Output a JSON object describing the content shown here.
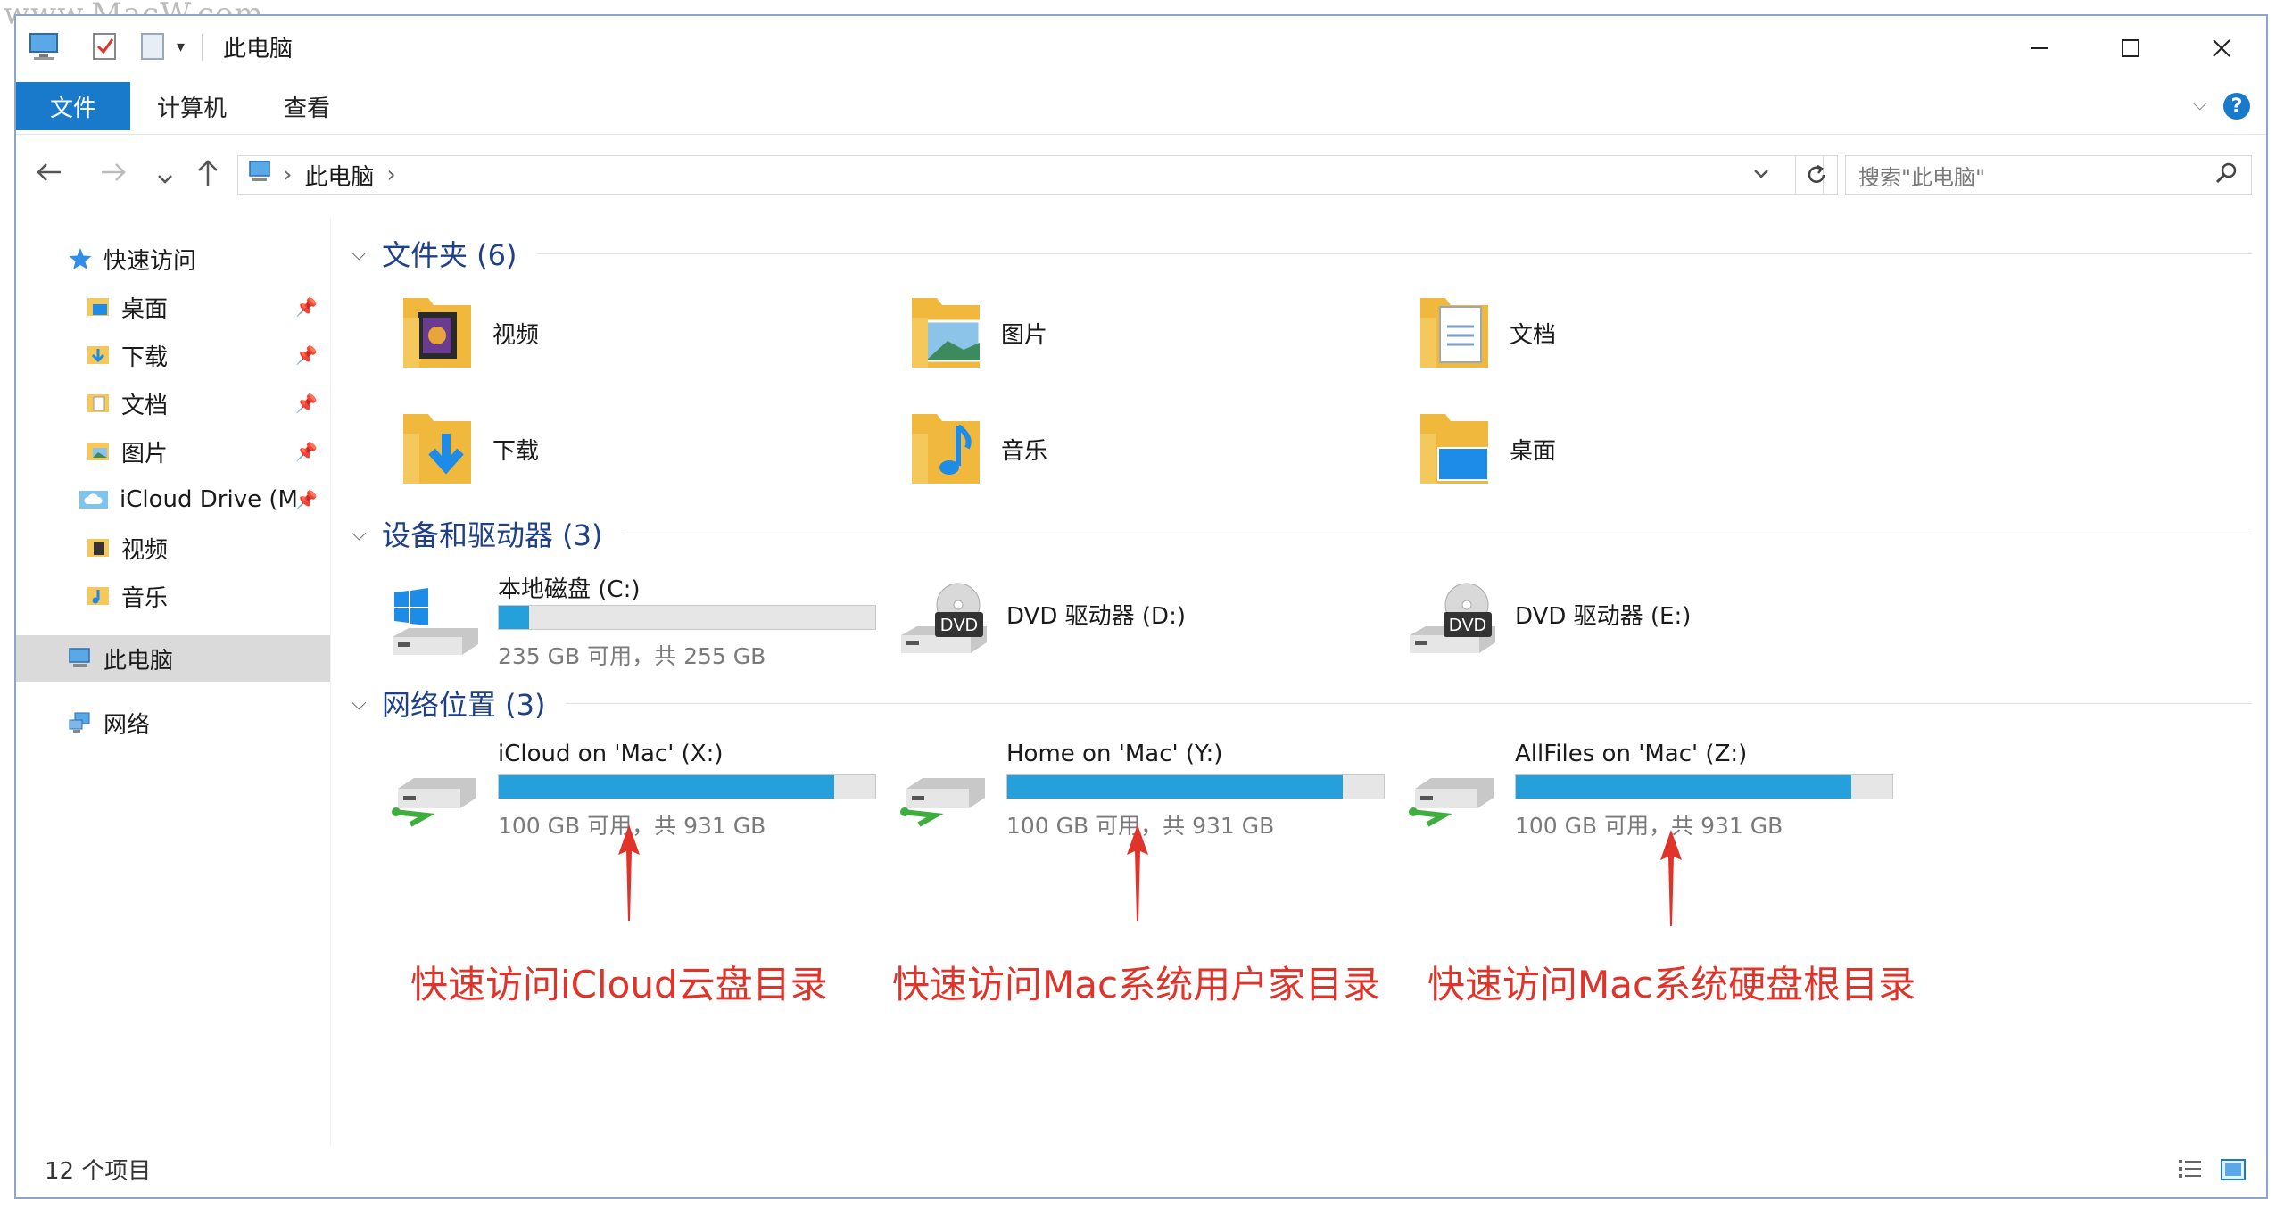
{
  "watermark": "www.MacW.com",
  "window": {
    "title": "此电脑"
  },
  "ribbon": {
    "tabs": [
      "文件",
      "计算机",
      "查看"
    ],
    "help": "?"
  },
  "address": {
    "crumb": "此电脑",
    "sep": "›"
  },
  "search": {
    "placeholder": "搜索\"此电脑\""
  },
  "sidebar": {
    "quick_access": "快速访问",
    "items": [
      {
        "label": "桌面"
      },
      {
        "label": "下载"
      },
      {
        "label": "文档"
      },
      {
        "label": "图片"
      },
      {
        "label": "iCloud Drive (M"
      },
      {
        "label": "视频"
      },
      {
        "label": "音乐"
      }
    ],
    "this_pc": "此电脑",
    "network": "网络"
  },
  "groups": {
    "folders": {
      "title": "文件夹 (6)",
      "items": [
        "视频",
        "图片",
        "文档",
        "下载",
        "音乐",
        "桌面"
      ]
    },
    "devices": {
      "title": "设备和驱动器 (3)",
      "local": {
        "name": "本地磁盘 (C:)",
        "sub": "235 GB 可用，共 255 GB",
        "used_fraction": 0.08
      },
      "dvd_d": {
        "name": "DVD 驱动器 (D:)"
      },
      "dvd_e": {
        "name": "DVD 驱动器 (E:)"
      },
      "dvd_label": "DVD"
    },
    "network": {
      "title": "网络位置 (3)",
      "items": [
        {
          "name": "iCloud on 'Mac' (X:)",
          "sub": "100 GB 可用，共 931 GB",
          "used_fraction": 0.89
        },
        {
          "name": "Home on 'Mac' (Y:)",
          "sub": "100 GB 可用，共 931 GB",
          "used_fraction": 0.89
        },
        {
          "name": "AllFiles on 'Mac' (Z:)",
          "sub": "100 GB 可用，共 931 GB",
          "used_fraction": 0.89
        }
      ]
    }
  },
  "annotations": [
    "快速访问iCloud云盘目录",
    "快速访问Mac系统用户家目录",
    "快速访问Mac系统硬盘根目录"
  ],
  "status": {
    "count": "12 个项目"
  },
  "colors": {
    "accent": "#1979ca",
    "bar_fill": "#26a0da",
    "annotation": "#e0332a",
    "group_title": "#1e3f8a"
  }
}
